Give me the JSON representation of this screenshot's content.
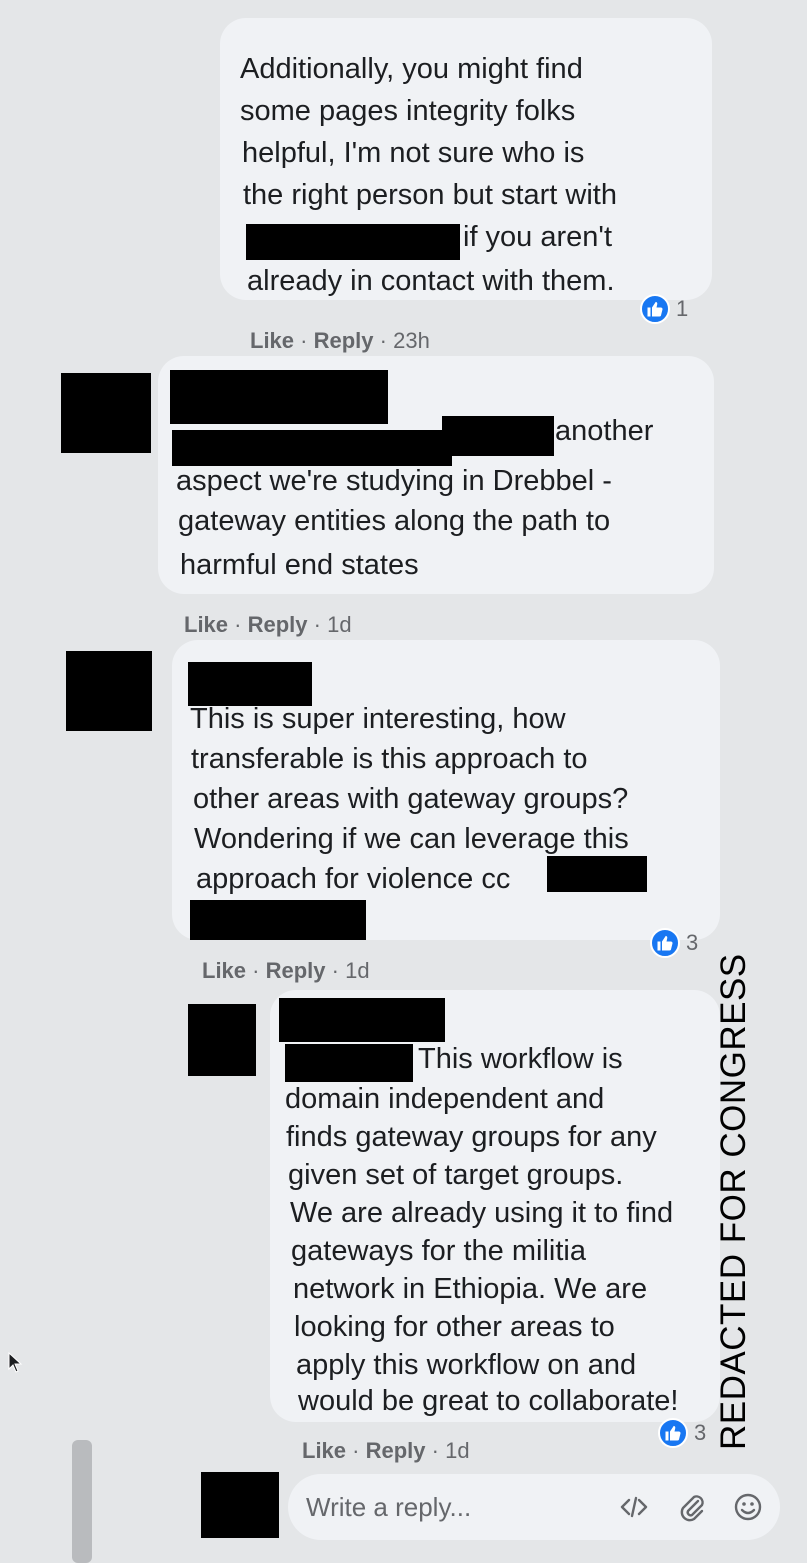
{
  "comments": [
    {
      "lines": [
        "Additionally, you might find",
        "some pages integrity folks",
        "helpful, I'm not sure who is",
        "the right person but start with",
        "if you aren't",
        "already in contact with them."
      ],
      "like": "Like",
      "reply": "Reply",
      "sep": "·",
      "time": "23h",
      "reaction_count": "1"
    },
    {
      "lines": [
        "another",
        "aspect we're studying in Drebbel -",
        "gateway entities along the path to",
        "harmful end states"
      ],
      "like": "Like",
      "reply": "Reply",
      "sep": "·",
      "time": "1d"
    },
    {
      "lines": [
        "This is super interesting, how",
        "transferable is this approach to",
        "other areas with gateway groups?",
        "Wondering if we can leverage this",
        "approach for violence cc"
      ],
      "like": "Like",
      "reply": "Reply",
      "sep": "·",
      "time": "1d",
      "reaction_count": "3"
    },
    {
      "lines": [
        "This workflow is",
        "domain independent and",
        "finds gateway groups for any",
        "given set of target groups.",
        "We are already using it to find",
        "gateways for the militia",
        "network in Ethiopia. We are",
        "looking for other areas to",
        "apply this workflow on and",
        "would be great to collaborate!"
      ],
      "like": "Like",
      "reply": "Reply",
      "sep": "·",
      "time": "1d",
      "reaction_count": "3"
    }
  ],
  "reply_box": {
    "placeholder": "Write a reply...",
    "icons": [
      "code-icon",
      "attachment-icon",
      "emoji-icon"
    ]
  },
  "watermark": "REDACTED FOR CONGRESS",
  "colors": {
    "bubble": "#f0f2f5",
    "like_blue": "#1877f2",
    "meta_gray": "#65676b",
    "redaction": "#000000"
  }
}
